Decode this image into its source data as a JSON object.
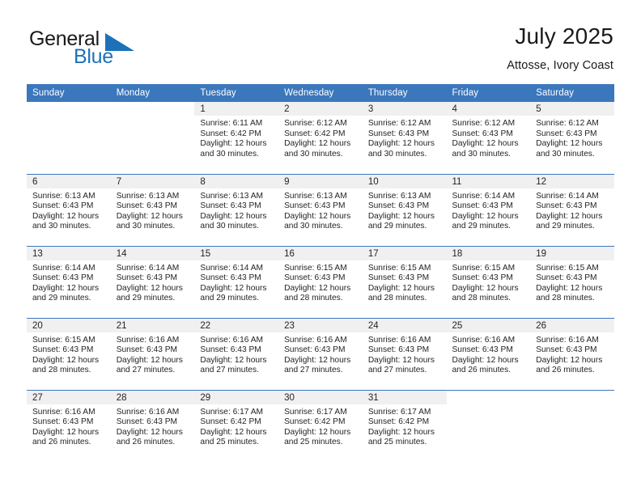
{
  "brand": {
    "name_top": "General",
    "name_bottom": "Blue",
    "mark": "triangle-flag-icon",
    "color_top": "#1a1a1a",
    "color_bottom": "#1d71b8"
  },
  "header": {
    "title": "July 2025",
    "subtitle": "Attosse, Ivory Coast"
  },
  "theme": {
    "header_blue": "#3b77bc",
    "daynum_band": "#f0f0f0",
    "text": "#231f20"
  },
  "weekdays": [
    "Sunday",
    "Monday",
    "Tuesday",
    "Wednesday",
    "Thursday",
    "Friday",
    "Saturday"
  ],
  "weeks": [
    [
      {
        "day": "",
        "sunrise": "",
        "sunset": "",
        "daylight": "",
        "blank": true
      },
      {
        "day": "",
        "sunrise": "",
        "sunset": "",
        "daylight": "",
        "blank": true
      },
      {
        "day": "1",
        "sunrise": "Sunrise: 6:11 AM",
        "sunset": "Sunset: 6:42 PM",
        "daylight": "Daylight: 12 hours and 30 minutes."
      },
      {
        "day": "2",
        "sunrise": "Sunrise: 6:12 AM",
        "sunset": "Sunset: 6:42 PM",
        "daylight": "Daylight: 12 hours and 30 minutes."
      },
      {
        "day": "3",
        "sunrise": "Sunrise: 6:12 AM",
        "sunset": "Sunset: 6:43 PM",
        "daylight": "Daylight: 12 hours and 30 minutes."
      },
      {
        "day": "4",
        "sunrise": "Sunrise: 6:12 AM",
        "sunset": "Sunset: 6:43 PM",
        "daylight": "Daylight: 12 hours and 30 minutes."
      },
      {
        "day": "5",
        "sunrise": "Sunrise: 6:12 AM",
        "sunset": "Sunset: 6:43 PM",
        "daylight": "Daylight: 12 hours and 30 minutes."
      }
    ],
    [
      {
        "day": "6",
        "sunrise": "Sunrise: 6:13 AM",
        "sunset": "Sunset: 6:43 PM",
        "daylight": "Daylight: 12 hours and 30 minutes."
      },
      {
        "day": "7",
        "sunrise": "Sunrise: 6:13 AM",
        "sunset": "Sunset: 6:43 PM",
        "daylight": "Daylight: 12 hours and 30 minutes."
      },
      {
        "day": "8",
        "sunrise": "Sunrise: 6:13 AM",
        "sunset": "Sunset: 6:43 PM",
        "daylight": "Daylight: 12 hours and 30 minutes."
      },
      {
        "day": "9",
        "sunrise": "Sunrise: 6:13 AM",
        "sunset": "Sunset: 6:43 PM",
        "daylight": "Daylight: 12 hours and 30 minutes."
      },
      {
        "day": "10",
        "sunrise": "Sunrise: 6:13 AM",
        "sunset": "Sunset: 6:43 PM",
        "daylight": "Daylight: 12 hours and 29 minutes."
      },
      {
        "day": "11",
        "sunrise": "Sunrise: 6:14 AM",
        "sunset": "Sunset: 6:43 PM",
        "daylight": "Daylight: 12 hours and 29 minutes."
      },
      {
        "day": "12",
        "sunrise": "Sunrise: 6:14 AM",
        "sunset": "Sunset: 6:43 PM",
        "daylight": "Daylight: 12 hours and 29 minutes."
      }
    ],
    [
      {
        "day": "13",
        "sunrise": "Sunrise: 6:14 AM",
        "sunset": "Sunset: 6:43 PM",
        "daylight": "Daylight: 12 hours and 29 minutes."
      },
      {
        "day": "14",
        "sunrise": "Sunrise: 6:14 AM",
        "sunset": "Sunset: 6:43 PM",
        "daylight": "Daylight: 12 hours and 29 minutes."
      },
      {
        "day": "15",
        "sunrise": "Sunrise: 6:14 AM",
        "sunset": "Sunset: 6:43 PM",
        "daylight": "Daylight: 12 hours and 29 minutes."
      },
      {
        "day": "16",
        "sunrise": "Sunrise: 6:15 AM",
        "sunset": "Sunset: 6:43 PM",
        "daylight": "Daylight: 12 hours and 28 minutes."
      },
      {
        "day": "17",
        "sunrise": "Sunrise: 6:15 AM",
        "sunset": "Sunset: 6:43 PM",
        "daylight": "Daylight: 12 hours and 28 minutes."
      },
      {
        "day": "18",
        "sunrise": "Sunrise: 6:15 AM",
        "sunset": "Sunset: 6:43 PM",
        "daylight": "Daylight: 12 hours and 28 minutes."
      },
      {
        "day": "19",
        "sunrise": "Sunrise: 6:15 AM",
        "sunset": "Sunset: 6:43 PM",
        "daylight": "Daylight: 12 hours and 28 minutes."
      }
    ],
    [
      {
        "day": "20",
        "sunrise": "Sunrise: 6:15 AM",
        "sunset": "Sunset: 6:43 PM",
        "daylight": "Daylight: 12 hours and 28 minutes."
      },
      {
        "day": "21",
        "sunrise": "Sunrise: 6:16 AM",
        "sunset": "Sunset: 6:43 PM",
        "daylight": "Daylight: 12 hours and 27 minutes."
      },
      {
        "day": "22",
        "sunrise": "Sunrise: 6:16 AM",
        "sunset": "Sunset: 6:43 PM",
        "daylight": "Daylight: 12 hours and 27 minutes."
      },
      {
        "day": "23",
        "sunrise": "Sunrise: 6:16 AM",
        "sunset": "Sunset: 6:43 PM",
        "daylight": "Daylight: 12 hours and 27 minutes."
      },
      {
        "day": "24",
        "sunrise": "Sunrise: 6:16 AM",
        "sunset": "Sunset: 6:43 PM",
        "daylight": "Daylight: 12 hours and 27 minutes."
      },
      {
        "day": "25",
        "sunrise": "Sunrise: 6:16 AM",
        "sunset": "Sunset: 6:43 PM",
        "daylight": "Daylight: 12 hours and 26 minutes."
      },
      {
        "day": "26",
        "sunrise": "Sunrise: 6:16 AM",
        "sunset": "Sunset: 6:43 PM",
        "daylight": "Daylight: 12 hours and 26 minutes."
      }
    ],
    [
      {
        "day": "27",
        "sunrise": "Sunrise: 6:16 AM",
        "sunset": "Sunset: 6:43 PM",
        "daylight": "Daylight: 12 hours and 26 minutes."
      },
      {
        "day": "28",
        "sunrise": "Sunrise: 6:16 AM",
        "sunset": "Sunset: 6:43 PM",
        "daylight": "Daylight: 12 hours and 26 minutes."
      },
      {
        "day": "29",
        "sunrise": "Sunrise: 6:17 AM",
        "sunset": "Sunset: 6:42 PM",
        "daylight": "Daylight: 12 hours and 25 minutes."
      },
      {
        "day": "30",
        "sunrise": "Sunrise: 6:17 AM",
        "sunset": "Sunset: 6:42 PM",
        "daylight": "Daylight: 12 hours and 25 minutes."
      },
      {
        "day": "31",
        "sunrise": "Sunrise: 6:17 AM",
        "sunset": "Sunset: 6:42 PM",
        "daylight": "Daylight: 12 hours and 25 minutes."
      },
      {
        "day": "",
        "sunrise": "",
        "sunset": "",
        "daylight": "",
        "blank": true
      },
      {
        "day": "",
        "sunrise": "",
        "sunset": "",
        "daylight": "",
        "blank": true
      }
    ]
  ]
}
